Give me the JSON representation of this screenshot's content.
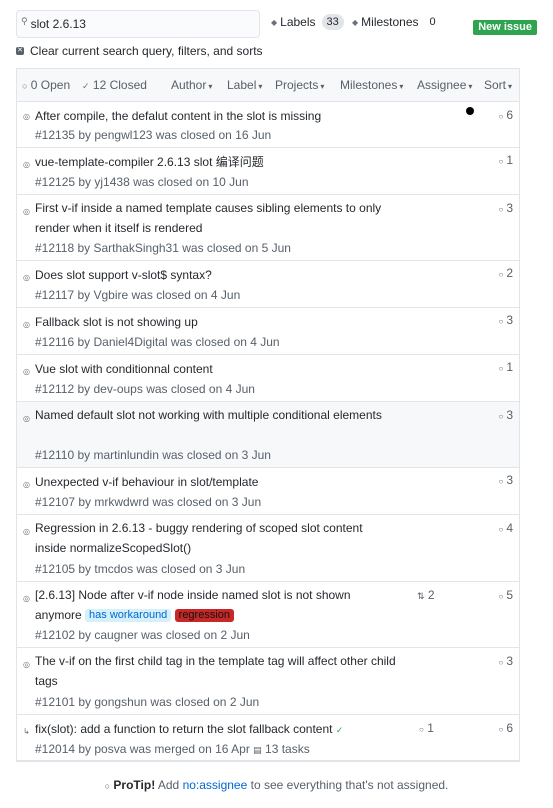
{
  "search": {
    "value": "slot 2.6.13"
  },
  "nav": {
    "labels": "Labels",
    "labels_count": "33",
    "milestones": "Milestones",
    "milestones_count": "0",
    "new_issue": "New issue"
  },
  "clear_text": "Clear current search query, filters, and sorts",
  "filters": {
    "open": "0 Open",
    "closed": "12 Closed",
    "author": "Author",
    "label": "Label",
    "projects": "Projects",
    "milestones": "Milestones",
    "assignee": "Assignee",
    "sort": "Sort"
  },
  "issues": [
    {
      "title": "After compile, the defalut content in the slot is missing",
      "meta": "#12135 by pengwl123 was closed on 16 Jun",
      "comments": "6"
    },
    {
      "title": "vue-template-compiler 2.6.13 slot 编译问题",
      "meta": "#12125 by yj1438 was closed on 10 Jun",
      "comments": "1"
    },
    {
      "title": "First v-if inside a named template causes sibling elements to only render when it itself is rendered",
      "meta": "#12118 by SarthakSingh31 was closed on 5 Jun",
      "comments": "3"
    },
    {
      "title": "Does slot support v-slot$ syntax?",
      "meta": "#12117 by Vgbire was closed on 4 Jun",
      "comments": "2"
    },
    {
      "title": "Fallback slot is not showing up",
      "meta": "#12116 by Daniel4Digital was closed on 4 Jun",
      "comments": "3"
    },
    {
      "title": "Vue slot with conditionnal content",
      "meta": "#12112 by dev-oups was closed on 4 Jun",
      "comments": "1"
    },
    {
      "title": "Named default slot not working with multiple conditional elements",
      "meta": "#12110 by martinlundin was closed on 3 Jun",
      "comments": "3"
    },
    {
      "title": "Unexpected v-if behaviour in slot/template",
      "meta": "#12107 by mrkwdwrd was closed on 3 Jun",
      "comments": "3"
    },
    {
      "title": "Regression in 2.6.13 - buggy rendering of scoped slot content inside normalizeScopedSlot()",
      "meta": "#12105 by tmcdos was closed on 3 Jun",
      "comments": "4"
    },
    {
      "title": "[2.6.13] Node after v-if node inside named slot is not shown anymore",
      "meta": "#12102 by caugner was closed on 2 Jun",
      "comments": "5",
      "prs": "2",
      "labels": [
        "has workaround",
        "regression"
      ]
    },
    {
      "title": "The v-if on the first child tag in the template tag will affect other child tags",
      "meta": "#12101 by gongshun was closed on 2 Jun",
      "comments": "3"
    },
    {
      "title": "fix(slot): add a function to return the slot fallback content",
      "meta": "#12014 by posva was merged on 16 Apr",
      "tasks": "13 tasks",
      "comments": "6",
      "prs": "1",
      "check": "✓"
    }
  ],
  "protip": {
    "bold": "ProTip!",
    "pre": "Add",
    "link": "no:assignee",
    "post": "to see everything that's not assigned."
  },
  "colors": {
    "accent_green": "#2ea44f",
    "link_blue": "#0366d6",
    "regression_red": "#c62828"
  }
}
